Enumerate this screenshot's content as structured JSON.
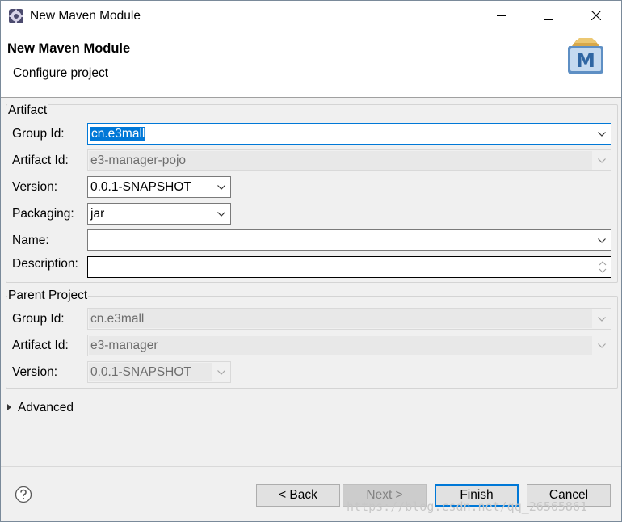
{
  "window": {
    "title": "New Maven Module",
    "icon": "eclipse-gear-icon"
  },
  "header": {
    "title": "New Maven Module",
    "subtitle": "Configure project",
    "logo": "maven-m-logo",
    "logo_letter": "M"
  },
  "artifact": {
    "label": "Artifact",
    "group_id": {
      "label": "Group Id:",
      "value": "cn.e3mall"
    },
    "artifact_id": {
      "label": "Artifact Id:",
      "value": "e3-manager-pojo"
    },
    "version": {
      "label": "Version:",
      "value": "0.0.1-SNAPSHOT"
    },
    "packaging": {
      "label": "Packaging:",
      "value": "jar"
    },
    "name": {
      "label": "Name:",
      "value": ""
    },
    "description": {
      "label": "Description:",
      "value": ""
    }
  },
  "parent": {
    "label": "Parent Project",
    "group_id": {
      "label": "Group Id:",
      "value": "cn.e3mall"
    },
    "artifact_id": {
      "label": "Artifact Id:",
      "value": "e3-manager"
    },
    "version": {
      "label": "Version:",
      "value": "0.0.1-SNAPSHOT"
    }
  },
  "advanced": {
    "label": "Advanced"
  },
  "buttons": {
    "back": "< Back",
    "next": "Next >",
    "finish": "Finish",
    "cancel": "Cancel"
  },
  "watermark": "https://blog.csdn.net/qq_26565861",
  "colors": {
    "accent": "#0078d7",
    "button_face": "#e1e1e1",
    "dialog_bg": "#f0f0f0"
  }
}
